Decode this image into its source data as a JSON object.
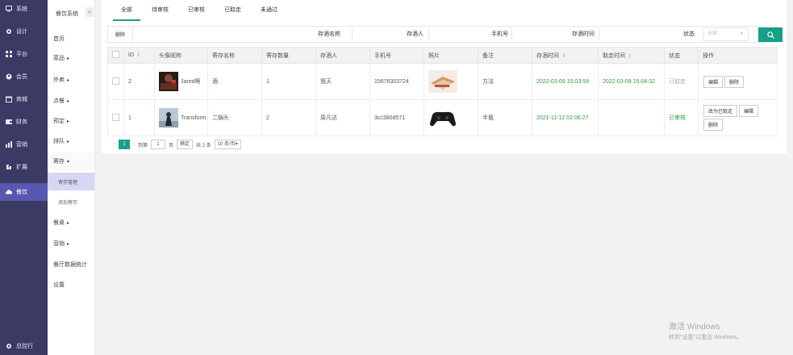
{
  "sidebar": {
    "items": [
      {
        "label": "系统",
        "icon": "monitor-icon"
      },
      {
        "label": "设计",
        "icon": "gear-icon"
      },
      {
        "label": "平台",
        "icon": "grid-icon"
      },
      {
        "label": "会员",
        "icon": "user-icon"
      },
      {
        "label": "商城",
        "icon": "shop-icon"
      },
      {
        "label": "财务",
        "icon": "wallet-icon"
      },
      {
        "label": "营销",
        "icon": "chart-icon"
      },
      {
        "label": "扩展",
        "icon": "puzzle-icon"
      },
      {
        "label": "餐饮",
        "icon": "cloud-icon"
      }
    ],
    "footer": "总控行"
  },
  "menu": {
    "title": "餐饮系统",
    "collapse": "«",
    "items": [
      {
        "label": "首页",
        "arrow": ""
      },
      {
        "label": "菜品",
        "arrow": "▸"
      },
      {
        "label": "外卖",
        "arrow": "▸"
      },
      {
        "label": "点餐",
        "arrow": "▸"
      },
      {
        "label": "预定",
        "arrow": "▸"
      },
      {
        "label": "排队",
        "arrow": "▸"
      },
      {
        "label": "寄存",
        "arrow": "▾"
      }
    ],
    "sub_items": [
      "寄存管理",
      "添加寄存"
    ],
    "items_after": [
      {
        "label": "餐桌",
        "arrow": "▸"
      },
      {
        "label": "营销",
        "arrow": "▸"
      },
      {
        "label": "餐厅数据统计",
        "arrow": ""
      },
      {
        "label": "设置",
        "arrow": ""
      }
    ]
  },
  "tabs": [
    "全部",
    "待审核",
    "已审核",
    "已取走",
    "未通过"
  ],
  "search": {
    "delete_label": "删除",
    "name_label": "存酒名称",
    "depositor_label": "存酒人",
    "phone_label": "手机号",
    "time_label": "存酒时间",
    "status_label": "状态",
    "status_value": "全部",
    "search_icon": "search-icon"
  },
  "table": {
    "headers": [
      "ID",
      "头像昵称",
      "寄存名称",
      "寄存数量",
      "存酒人",
      "手机号",
      "照片",
      "备注",
      "存酒时间",
      "取走时间",
      "状态",
      "操作"
    ],
    "rows": [
      {
        "id": "2",
        "nickname": "Jared啊",
        "name": "酒",
        "qty": "1",
        "depositor": "我天",
        "phone": "15676303724",
        "note": "方法",
        "deposit_time": "2022-03-09 15:03:59",
        "pickup_time": "2022-03-09 15:04:32",
        "status": "已取走",
        "ops": [
          "编辑",
          "删除"
        ]
      },
      {
        "id": "1",
        "nickname": "Transform",
        "name": "二锅头",
        "qty": "2",
        "depositor": "周凡达",
        "phone": "3cc380d571",
        "note": "半瓶",
        "deposit_time": "2021-11-12 02:06:27",
        "pickup_time": "",
        "status": "已审核",
        "ops": [
          "改为已取走",
          "编辑",
          "删除"
        ]
      }
    ]
  },
  "pager": {
    "prev": "‹",
    "current": "1",
    "next": "›",
    "goto_label": "到第",
    "goto_value": "1",
    "page_unit": "页",
    "confirm": "确定",
    "total": "共 2 条",
    "per_page": "10 条/页"
  },
  "watermark": {
    "line1": "激活 Windows",
    "line2": "转到\"设置\"以激活 Windows。"
  },
  "colors": {
    "sidebar": "#3a3a64",
    "sidebar_active": "#5858b0",
    "accent": "#15a089",
    "status_green": "#2a9d3a"
  }
}
